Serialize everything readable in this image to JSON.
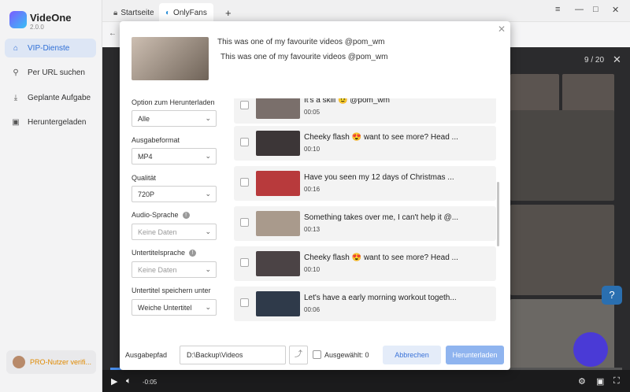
{
  "app": {
    "name": "VideOne",
    "version": "2.0.0"
  },
  "sidebar": {
    "items": [
      {
        "label": "VIP-Dienste",
        "icon": "home-icon"
      },
      {
        "label": "Per URL suchen",
        "icon": "search-icon"
      },
      {
        "label": "Geplante Aufgabe",
        "icon": "download-icon"
      },
      {
        "label": "Heruntergeladen",
        "icon": "folder-icon"
      }
    ],
    "pro_label": "PRO-Nutzer verifi..."
  },
  "tabs": [
    {
      "label": "Startseite",
      "icon": "lock-icon"
    },
    {
      "label": "OnlyFans",
      "icon": "onlyfans-icon"
    }
  ],
  "viewer": {
    "counter": "9 / 20",
    "time": "-0:05"
  },
  "dialog": {
    "title": "This was one of my favourite videos @pom_wm",
    "subtitle": "This was one of my favourite videos @pom_wm",
    "options": [
      {
        "label": "Option zum Herunterladen",
        "value": "Alle",
        "info": false,
        "disabled": false
      },
      {
        "label": "Ausgabeformat",
        "value": "MP4",
        "info": false,
        "disabled": false
      },
      {
        "label": "Qualität",
        "value": "720P",
        "info": false,
        "disabled": false
      },
      {
        "label": "Audio-Sprache",
        "value": "Keine Daten",
        "info": true,
        "disabled": true
      },
      {
        "label": "Untertitelsprache",
        "value": "Keine Daten",
        "info": true,
        "disabled": true
      },
      {
        "label": "Untertitel speichern unter",
        "value": "Weiche Untertitel",
        "info": false,
        "disabled": false
      }
    ],
    "items": [
      {
        "title": "It's a skill 😉 @pom_wm",
        "duration": "00:05"
      },
      {
        "title": "Cheeky flash 😍 want to see more? Head ...",
        "duration": "00:10"
      },
      {
        "title": "Have you seen my 12 days of Christmas ...",
        "duration": "00:16"
      },
      {
        "title": "Something takes over me, I can't help it @...",
        "duration": "00:13"
      },
      {
        "title": "Cheeky flash 😍 want to see more? Head ...",
        "duration": "00:10"
      },
      {
        "title": "Let's have a early morning workout togeth...",
        "duration": "00:06"
      }
    ],
    "footer": {
      "path_label": "Ausgabepfad",
      "path_value": "D:\\Backup\\Videos",
      "selected_label": "Ausgewählt: 0",
      "cancel": "Abbrechen",
      "download": "Herunterladen"
    }
  }
}
